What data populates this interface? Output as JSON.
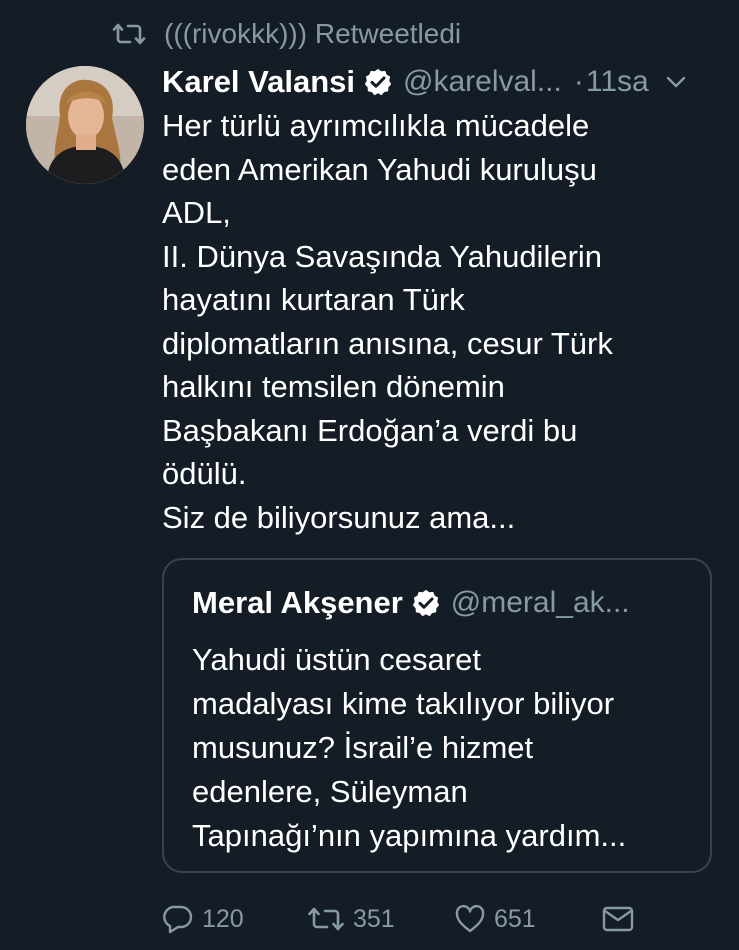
{
  "retweet": {
    "icon": "retweet-icon",
    "text": "(((rivokkk))) Retweetledi"
  },
  "tweet": {
    "avatar_icon": "avatar",
    "name": "Karel Valansi",
    "verified_icon": "verified-badge-icon",
    "handle": "@karelval...",
    "dot": "·",
    "time": "11sa",
    "text": "Her türlü ayrımcılıkla mücadele\neden Amerikan Yahudi kuruluşu\nADL,\nII. Dünya Savaşında Yahudilerin\nhayatını kurtaran Türk\ndiplomatların anısına, cesur Türk\nhalkını temsilen dönemin\nBaşbakanı Erdoğan’a verdi bu\nödülü.\nSiz de biliyorsunuz ama..."
  },
  "quote": {
    "name": "Meral Akşener",
    "handle": "@meral_ak...",
    "text": "Yahudi üstün cesaret\nmadalyası kime takılıyor biliyor\nmusunuz? İsrail’e hizmet\nedenlere, Süleyman\nTapınağı’nın yapımına yardım..."
  },
  "actions": {
    "reply_count": "120",
    "retweet_count": "351",
    "like_count": "651"
  },
  "colors": {
    "background": "#141d26",
    "secondary_text": "#8899a6",
    "border": "#38444d"
  }
}
